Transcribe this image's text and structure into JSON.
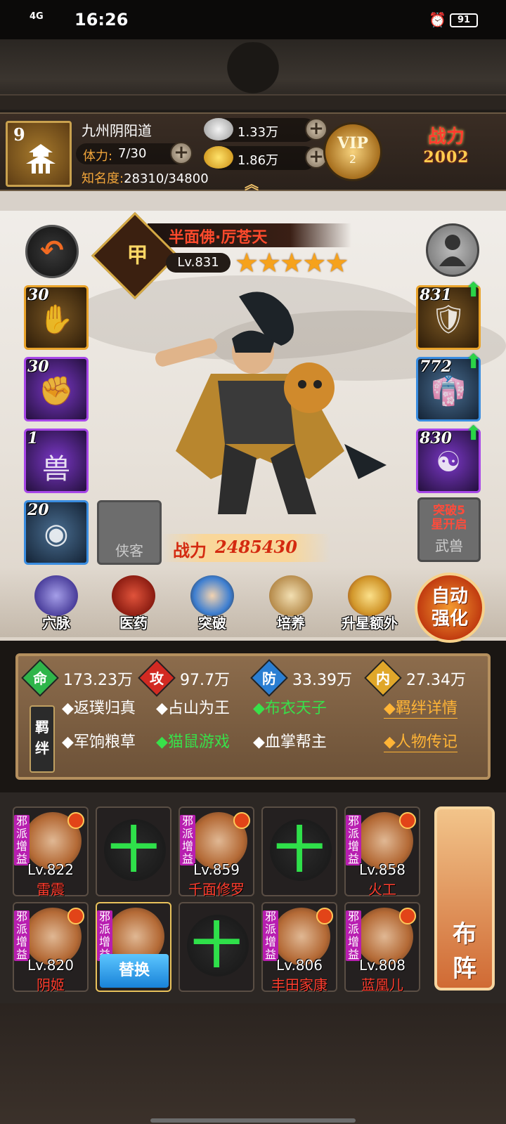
{
  "status_bar": {
    "network": "4G",
    "time": "16:26",
    "battery": "91"
  },
  "player": {
    "level": "9",
    "name": "九州阴阳道",
    "stamina_label": "体力:",
    "stamina_value": "7/30",
    "fame_label": "知名度:",
    "fame_value": "28310/34800",
    "silver": "1.33万",
    "gold": "1.86万",
    "vip_label": "VIP",
    "vip_level": "2",
    "power_label": "战力",
    "power_value": "2002"
  },
  "hero": {
    "name": "半面佛·厉苍天",
    "seal_char": "甲",
    "level": "Lv.831",
    "stars": 5,
    "left_slots": [
      {
        "count": "30",
        "icon": "palm-skill-icon",
        "color": "gold"
      },
      {
        "count": "30",
        "icon": "fist-skill-icon",
        "color": "purple"
      },
      {
        "count": "1",
        "icon": "beast-skill-icon",
        "glyph": "兽",
        "color": "purple"
      },
      {
        "count": "20",
        "icon": "token-icon",
        "color": "blue"
      }
    ],
    "companion_label": "侠客",
    "right_slots": [
      {
        "count": "831",
        "icon": "bracer-icon",
        "color": "gold"
      },
      {
        "count": "772",
        "icon": "robe-icon",
        "color": "blue"
      },
      {
        "count": "830",
        "icon": "bagua-icon",
        "color": "purple"
      }
    ],
    "breakthrough_line1": "突破5",
    "breakthrough_line2": "星开启",
    "beast_label": "武兽",
    "battle_power_label": "战力",
    "battle_power_value": "2485430"
  },
  "functions": [
    {
      "label": "穴脉",
      "icon": "meridian-icon"
    },
    {
      "label": "医药",
      "icon": "medicine-icon"
    },
    {
      "label": "突破",
      "icon": "breakthrough-icon"
    },
    {
      "label": "培养",
      "icon": "cultivate-icon"
    },
    {
      "label": "升星额外",
      "icon": "star-up-icon"
    }
  ],
  "auto_enhance": {
    "line1": "自动",
    "line2": "强化"
  },
  "stats": [
    {
      "key": "命",
      "value": "173.23万",
      "color": "#2fb54a"
    },
    {
      "key": "攻",
      "value": "97.7万",
      "color": "#d22a22"
    },
    {
      "key": "防",
      "value": "33.39万",
      "color": "#2a7ed2"
    },
    {
      "key": "内",
      "value": "27.34万",
      "color": "#e0a72a"
    }
  ],
  "bonds": {
    "tag_line1": "羁",
    "tag_line2": "绊",
    "row1": [
      "◆返璞归真",
      "◆占山为王",
      "◆布衣天子"
    ],
    "row2": [
      "◆军饷粮草",
      "◆猫鼠游戏",
      "◆血掌帮主"
    ],
    "detail_link": "◆羁绊详情",
    "bio_link": "◆人物传记"
  },
  "team": {
    "faction_tag": "邪派增益",
    "members": [
      {
        "level": "Lv.822",
        "name": "雷震"
      },
      {
        "level": "Lv.859",
        "name": "千面修罗"
      },
      {
        "level": "Lv.858",
        "name": "火工"
      },
      {
        "level": "Lv.820",
        "name": "阴姬"
      },
      {
        "level": "Lv.806",
        "name": "丰田家康"
      },
      {
        "level": "Lv.808",
        "name": "蓝凰儿"
      }
    ],
    "swap_label": "替换",
    "empty_plus": "十",
    "formation_line1": "布",
    "formation_line2": "阵"
  }
}
